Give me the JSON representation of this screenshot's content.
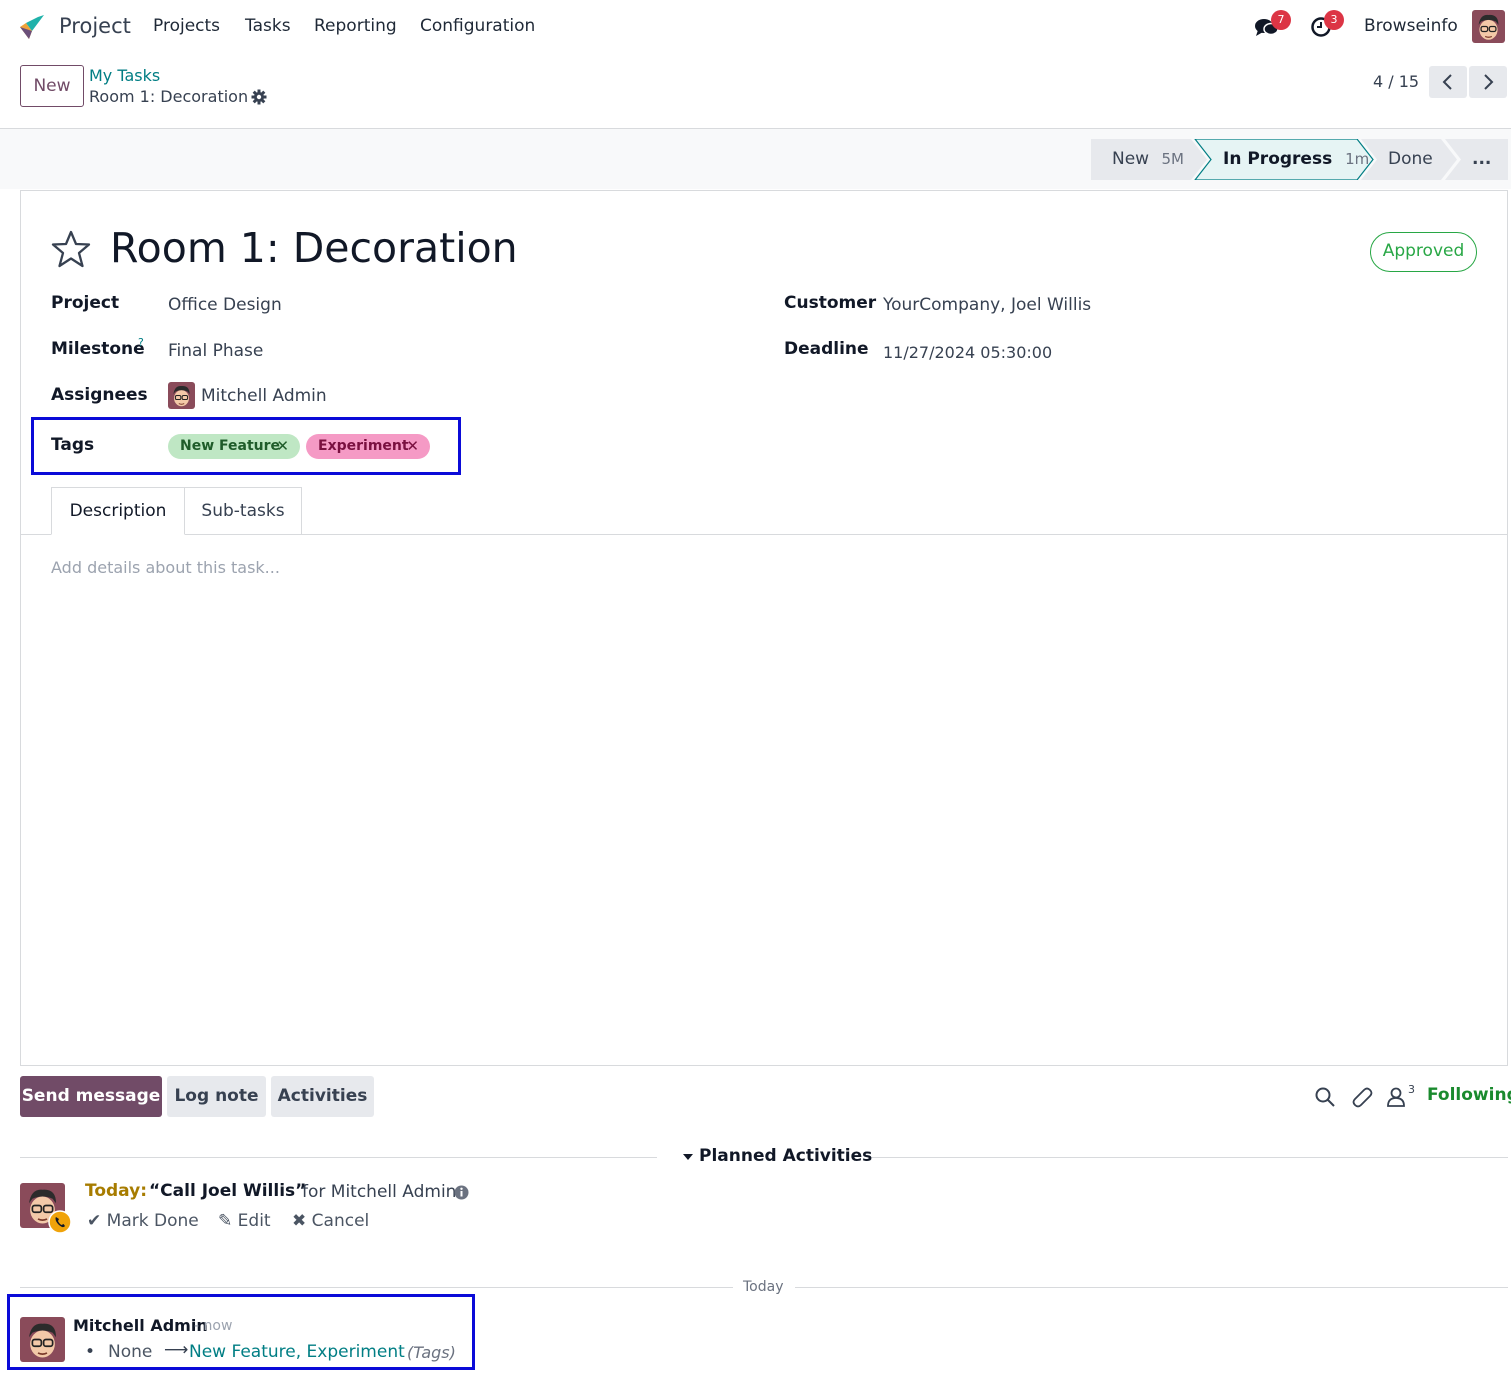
{
  "nav": {
    "app_name": "Project",
    "menu": [
      "Projects",
      "Tasks",
      "Reporting",
      "Configuration"
    ],
    "messages_count": "7",
    "activities_count": "3",
    "company": "Browseinfo"
  },
  "control": {
    "new_label": "New",
    "breadcrumb_parent": "My Tasks",
    "breadcrumb_current": "Room 1: Decoration",
    "pager": "4 / 15"
  },
  "stages": [
    {
      "label": "New",
      "time": "5M"
    },
    {
      "label": "In Progress",
      "time": "1m"
    },
    {
      "label": "Done",
      "time": ""
    },
    {
      "label": "...",
      "time": ""
    }
  ],
  "task": {
    "title": "Room 1: Decoration",
    "state": "Approved",
    "project_label": "Project",
    "project": "Office Design",
    "milestone_label": "Milestone",
    "milestone_help": "?",
    "milestone": "Final Phase",
    "assignees_label": "Assignees",
    "assignee": "Mitchell Admin",
    "tags_label": "Tags",
    "tags": [
      {
        "name": "New Feature",
        "color": "#bfe7c4",
        "text": "#1f5c2a"
      },
      {
        "name": "Experiment",
        "color": "#f59ac5",
        "text": "#7a1040"
      }
    ],
    "customer_label": "Customer",
    "customer": "YourCompany, Joel Willis",
    "deadline_label": "Deadline",
    "deadline": "11/27/2024 05:30:00"
  },
  "tabs": [
    "Description",
    "Sub-tasks"
  ],
  "description_placeholder": "Add details about this task...",
  "chatter": {
    "send_message": "Send message",
    "log_note": "Log note",
    "activities": "Activities",
    "followers_count": "3",
    "following": "Following",
    "planned_header": "Planned Activities",
    "activity": {
      "when": "Today:",
      "summary": "“Call Joel Willis”",
      "for": "for Mitchell Admin",
      "mark_done": "Mark Done",
      "edit": "Edit",
      "cancel": "Cancel"
    },
    "date_separator": "Today",
    "message": {
      "author": "Mitchell Admin",
      "time": "- now",
      "old": "None",
      "new": "New Feature, Experiment",
      "field": "(Tags)"
    }
  },
  "colors": {
    "brand": "#714b67",
    "link": "#017e84",
    "success": "#28a745"
  }
}
